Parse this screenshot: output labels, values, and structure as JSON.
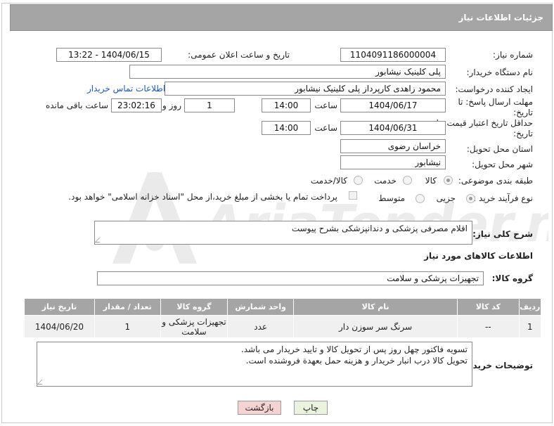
{
  "header": {
    "title": "جزئیات اطلاعات نیاز"
  },
  "fields": {
    "need_number_label": "شماره نیاز:",
    "need_number": "1104091186000004",
    "announce_label": "تاریخ و ساعت اعلان عمومی:",
    "announce_value": "1404/06/15 - 13:22",
    "buyer_org_label": "نام دستگاه خریدار:",
    "buyer_org": "پلی کلینیک نیشابور",
    "creator_label": "ایجاد کننده درخواست:",
    "creator": "محمود زاهدی کارپرداز پلی کلینیک نیشابور",
    "contact_link": "اطلاعات تماس خریدار",
    "deadline_label": "مهلت ارسال پاسخ: تا تاریخ:",
    "deadline_date": "1404/06/17",
    "time_label": "ساعت",
    "deadline_time": "14:00",
    "days_value": "1",
    "days_label": "روز و",
    "remaining_time": "23:02:16",
    "remaining_label": "ساعت باقی مانده",
    "validity_label": "حداقل تاریخ اعتبار قیمت: تا تاریخ:",
    "validity_date": "1404/06/31",
    "validity_time": "14:00",
    "province_label": "استان محل تحویل:",
    "province": "خراسان رضوی",
    "city_label": "شهر محل تحویل:",
    "city": "نیشابور",
    "category_label": "طبقه بندی موضوعی:",
    "category_options": [
      "کالا",
      "خدمت",
      "کالا/خدمت"
    ],
    "category_selected": "کالا",
    "process_label": "نوع فرآیند خرید :",
    "process_options": [
      "جزیی",
      "متوسط"
    ],
    "process_selected": "جزیی",
    "payment_note": "پرداخت تمام یا بخشی از مبلغ خرید،از محل \"اسناد خزانه اسلامی\" خواهد بود."
  },
  "description": {
    "label": "شرح کلی نیاز:",
    "value": "اقلام مصرفی پزشکی و دندانپزشکی بشرح پیوست"
  },
  "goods": {
    "section_title": "اطلاعات کالاهای مورد نیاز",
    "group_label": "گروه کالا:",
    "group_value": "تجهیزات پزشکی و سلامت"
  },
  "table": {
    "headers": [
      "ردیف",
      "کد کالا",
      "نام کالا",
      "واحد شمارش",
      "گروه کالا",
      "تعداد / مقدار",
      "تاریخ نیاز"
    ],
    "rows": [
      [
        "1",
        "--",
        "سرنگ سر سوزن دار",
        "عدد",
        "تجهیزات پزشکی و سلامت",
        "1",
        "1404/06/20"
      ]
    ]
  },
  "buyer_notes": {
    "label": "توضیحات خریدار:",
    "line1": "تسویه فاکتور چهل روز پس از تحویل کالا و تایید خریدار می باشد.",
    "line2": "تحویل کالا درب انبار خریدار و هزینه حمل بعهدة فروشنده است."
  },
  "buttons": {
    "print": "چاپ",
    "back": "بازگشت"
  },
  "watermark": {
    "text": "AriaTender.net"
  },
  "colors": {
    "header_bg": "#a5a5a5",
    "link": "#1a56b8",
    "back_button": "#f6d3d3",
    "print_button": "#e9f3de"
  }
}
